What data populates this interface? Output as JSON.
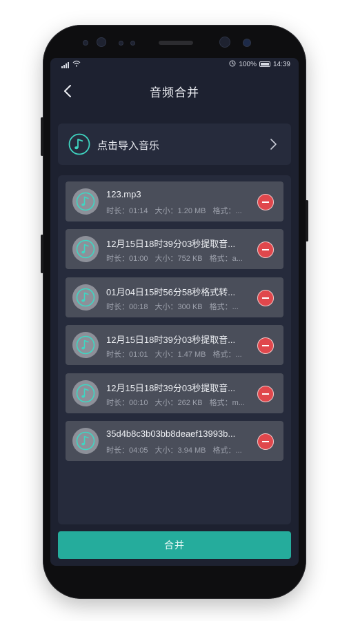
{
  "status_bar": {
    "left": "⁵ᵍ",
    "battery_percent": "100%",
    "time": "14:39"
  },
  "header": {
    "title": "音频合并"
  },
  "import": {
    "label": "点击导入音乐"
  },
  "meta_labels": {
    "duration": "时长：",
    "size": "大小：",
    "format": "格式："
  },
  "files": [
    {
      "name": "123.mp3",
      "duration": "01:14",
      "size": "1.20 MB",
      "format": "..."
    },
    {
      "name": "12月15日18时39分03秒提取音...",
      "duration": "01:00",
      "size": "752 KB",
      "format": "a..."
    },
    {
      "name": "01月04日15时56分58秒格式转...",
      "duration": "00:18",
      "size": "300 KB",
      "format": "..."
    },
    {
      "name": "12月15日18时39分03秒提取音...",
      "duration": "01:01",
      "size": "1.47 MB",
      "format": "..."
    },
    {
      "name": "12月15日18时39分03秒提取音...",
      "duration": "00:10",
      "size": "262 KB",
      "format": "m..."
    },
    {
      "name": "35d4b8c3b03bb8deaef13993b...",
      "duration": "04:05",
      "size": "3.94 MB",
      "format": "..."
    }
  ],
  "actions": {
    "merge_label": "合并"
  },
  "colors": {
    "background": "#1d2130",
    "card": "#262b3c",
    "item": "#4a4e5a",
    "accent": "#25ac9c",
    "icon_teal": "#3fd6c2",
    "remove": "#e0474c"
  }
}
